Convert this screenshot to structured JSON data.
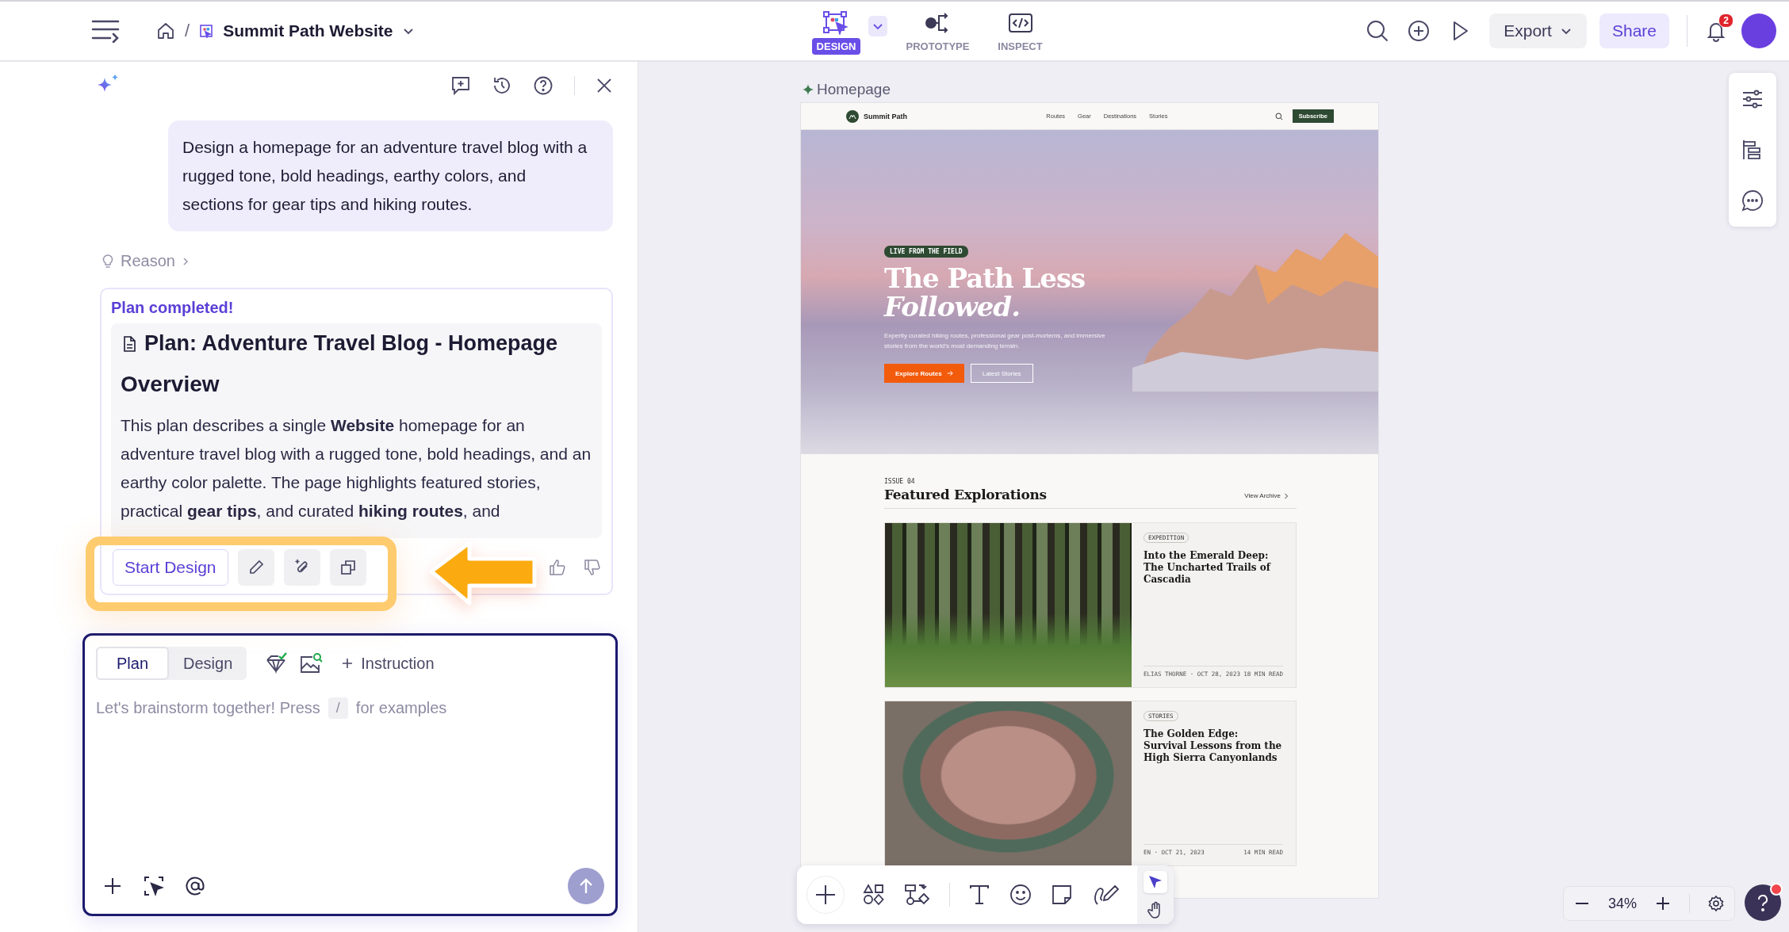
{
  "top_bar": {
    "breadcrumb_separator": "/",
    "project": "Summit Path Website",
    "modes": [
      {
        "kind": "design",
        "label": "DESIGN",
        "selected": true
      },
      {
        "kind": "prototype",
        "label": "PROTOTYPE",
        "selected": false
      },
      {
        "kind": "inspect",
        "label": "INSPECT",
        "selected": false
      }
    ],
    "export": "Export",
    "share": "Share",
    "notification_count": "2"
  },
  "assistant": {
    "prompt": "Design a homepage for an adventure travel blog with a rugged tone, bold headings, earthy colors, and sections for gear tips and hiking routes.",
    "reason": "Reason",
    "plan": {
      "status": "Plan completed!",
      "title": "Plan: Adventure Travel Blog - Homepage",
      "heading": "Overview",
      "body": "This plan describes a single **Website** homepage for an adventure travel blog with a rugged tone, bold headings, and an earthy color palette. The page highlights featured stories, practical **gear tips**, and curated **hiking routes**, and"
    },
    "start_design": "Start Design"
  },
  "composer": {
    "tabs": [
      {
        "label": "Plan",
        "selected": true
      },
      {
        "label": "Design",
        "selected": false
      }
    ],
    "instruction": "Instruction",
    "placeholder": "Let's brainstorm together! Press",
    "shortcut_key": "/",
    "placeholder_end": "for examples",
    "send_disabled": true
  },
  "canvas": {
    "frame_label": "Homepage",
    "zoom": "34%",
    "site": {
      "brand": "Summit Path",
      "nav": [
        "Routes",
        "Gear",
        "Destinations",
        "Stories"
      ],
      "subscribe": "Subscribe",
      "hero": {
        "badge": "LIVE FROM THE FIELD",
        "title_line_1": "The Path Less",
        "title_line_2": "Followed.",
        "lede": "Expertly curated hiking routes, professional gear post-mortems, and immersive stories from the world's most demanding terrain.",
        "primary": "Explore Routes",
        "secondary": "Latest Stories"
      },
      "section": {
        "eyebrow": "ISSUE 04",
        "heading": "Featured Explorations",
        "link": "View Archive"
      },
      "articles": [
        {
          "kind": "forest",
          "tag": "EXPEDITION",
          "title": "Into the Emerald Deep: The Uncharted Trails of Cascadia",
          "byline": "ELIAS THORNE · OCT 28, 2023",
          "read_time": "18 MIN READ"
        },
        {
          "kind": "canyon",
          "tag": "STORIES",
          "title": "The Golden Edge: Survival Lessons from the High Sierra Canyonlands",
          "byline": "EN · OCT 21, 2023",
          "read_time": "14 MIN READ"
        }
      ]
    }
  }
}
